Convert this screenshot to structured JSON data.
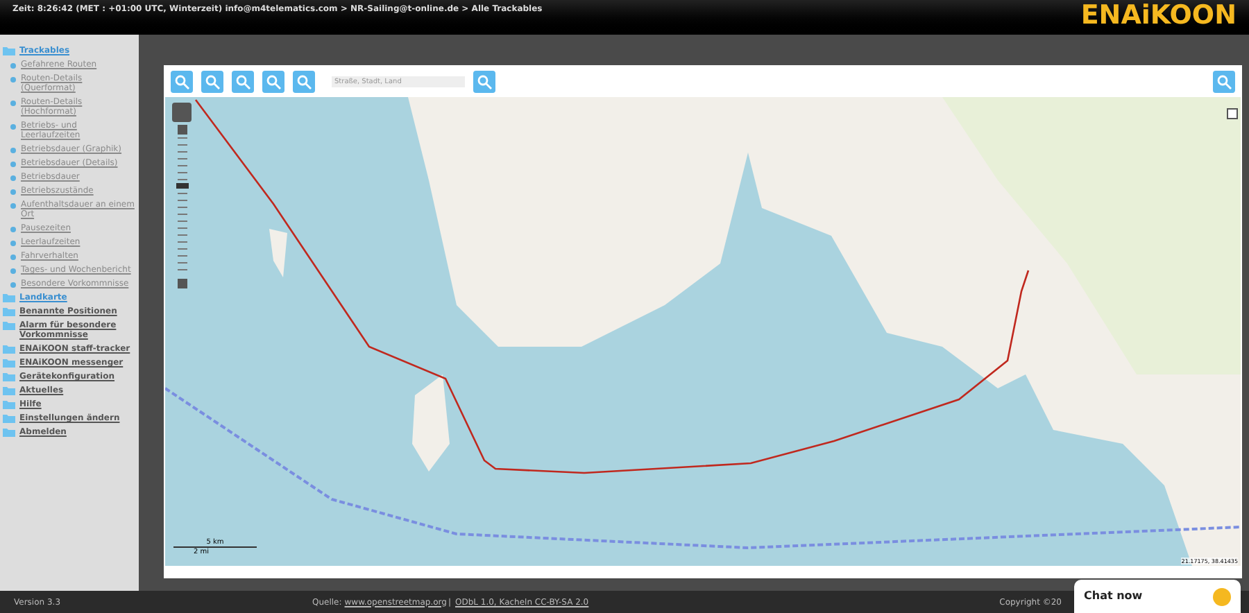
{
  "header": {
    "status": "Zeit: 8:26:42 (MET : +01:00 UTC, Winterzeit) info@m4telematics.com > NR-Sailing@t-online.de > Alle Trackables",
    "logo": "ENAiKOON"
  },
  "sidebar": {
    "items": [
      {
        "label": "Trackables",
        "selected": true,
        "children": [
          {
            "label": "Gefahrene Routen"
          },
          {
            "label": "Routen-Details (Querformat)"
          },
          {
            "label": "Routen-Details (Hochformat)"
          },
          {
            "label": "Betriebs- und Leerlaufzeiten"
          },
          {
            "label": "Betriebsdauer (Graphik)"
          },
          {
            "label": "Betriebsdauer (Details)"
          },
          {
            "label": "Betriebsdauer"
          },
          {
            "label": "Betriebszustände"
          },
          {
            "label": "Aufenthaltsdauer an einem Ort"
          },
          {
            "label": "Pausezeiten"
          },
          {
            "label": "Leerlaufzeiten"
          },
          {
            "label": "Fahrverhalten"
          },
          {
            "label": "Tages- und Wochenbericht"
          },
          {
            "label": "Besondere Vorkommnisse"
          }
        ]
      },
      {
        "label": "Landkarte",
        "selected": true
      },
      {
        "label": "Benannte Positionen",
        "selected": false
      },
      {
        "label": "Alarm für besondere Vorkommnisse",
        "selected": false
      },
      {
        "label": "ENAiKOON staff-tracker",
        "selected": false
      },
      {
        "label": "ENAiKOON messenger",
        "selected": false
      },
      {
        "label": "Gerätekonfiguration",
        "selected": false
      },
      {
        "label": "Aktuelles",
        "selected": false
      },
      {
        "label": "Hilfe",
        "selected": false
      },
      {
        "label": "Einstellungen ändern",
        "selected": false
      },
      {
        "label": "Abmelden",
        "selected": false
      }
    ]
  },
  "map": {
    "zoom": {
      "level": 0.65
    },
    "search": {
      "placeholder": "Straße, Stadt, Land"
    },
    "scale": [
      "5 km",
      "2 mi"
    ],
    "coordinates": "21.17175, 38.41435"
  },
  "footer": {
    "version": "Version 3.3",
    "source_label": "Quelle:",
    "source_link": "www.openstreetmap.org",
    "separator": "|",
    "license_link": "ODbL 1.0, Kacheln CC-BY-SA 2.0",
    "copyright": "Copyright ©20"
  },
  "chat": {
    "label": "Chat now"
  }
}
